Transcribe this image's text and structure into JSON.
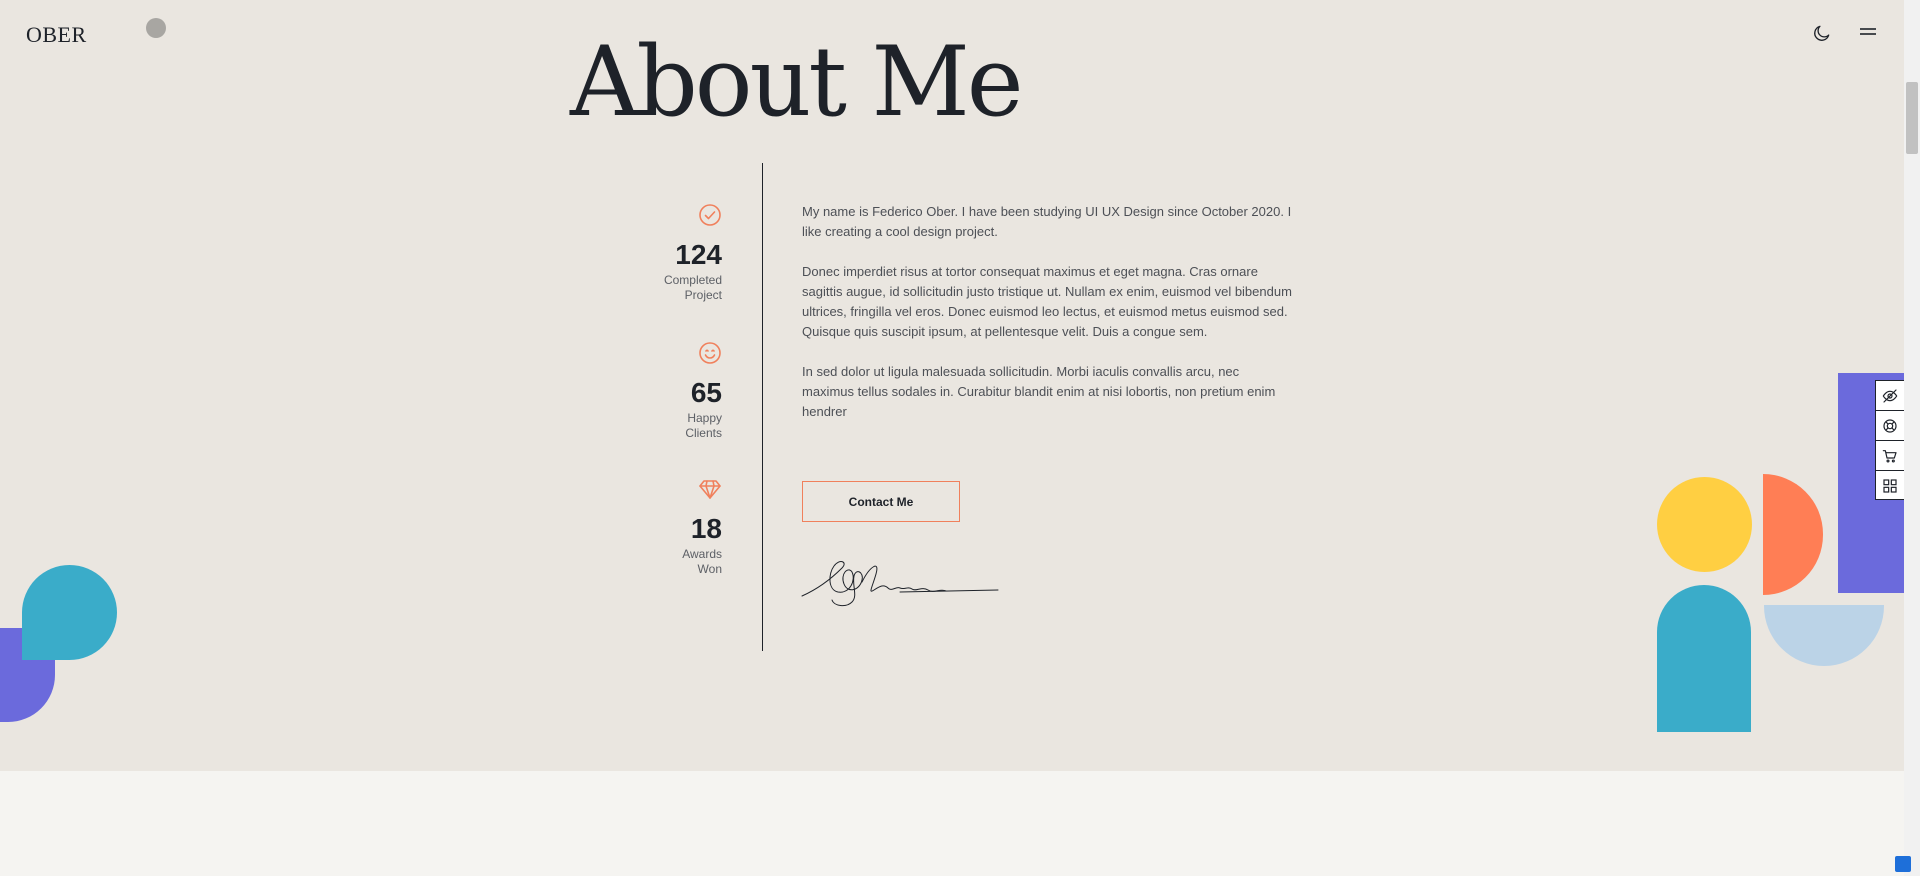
{
  "header": {
    "logo": "OBER",
    "theme_icon": "moon-icon",
    "menu_icon": "hamburger-menu-icon"
  },
  "about": {
    "title": "About Me",
    "stats": [
      {
        "icon": "check-circle-icon",
        "value": "124",
        "label_line1": "Completed",
        "label_line2": "Project"
      },
      {
        "icon": "smiley-icon",
        "value": "65",
        "label_line1": "Happy",
        "label_line2": "Clients"
      },
      {
        "icon": "diamond-icon",
        "value": "18",
        "label_line1": "Awards",
        "label_line2": "Won"
      }
    ],
    "paragraphs": [
      "My name is Federico Ober. I have been studying UI UX Design since October 2020. I like creating a cool design project.",
      "Donec imperdiet risus at tortor consequat maximus et eget magna. Cras ornare sagittis augue, id sollicitudin justo tristique ut. Nullam ex enim, euismod vel bibendum ultrices, fringilla vel eros. Donec euismod leo lectus, et euismod metus euismod sed. Quisque quis suscipit ipsum, at pellentesque velit. Duis a congue sem.",
      "In sed dolor ut ligula malesuada sollicitudin. Morbi iaculis convallis arcu, nec maximus tellus sodales in. Curabitur blandit enim at nisi lobortis, non pretium enim hendrer"
    ],
    "contact_button": "Contact Me"
  },
  "side_panel": {
    "items": [
      "eye-off-icon",
      "support-icon",
      "cart-icon",
      "grid-icon"
    ]
  },
  "colors": {
    "background": "#eae6e0",
    "accent": "#f0805c",
    "teal": "#3aacc9",
    "purple": "#6b6adc",
    "yellow": "#ffcf42",
    "coral": "#ff7e55",
    "light_blue": "#bbd3e7",
    "text_dark": "#1e2229"
  }
}
